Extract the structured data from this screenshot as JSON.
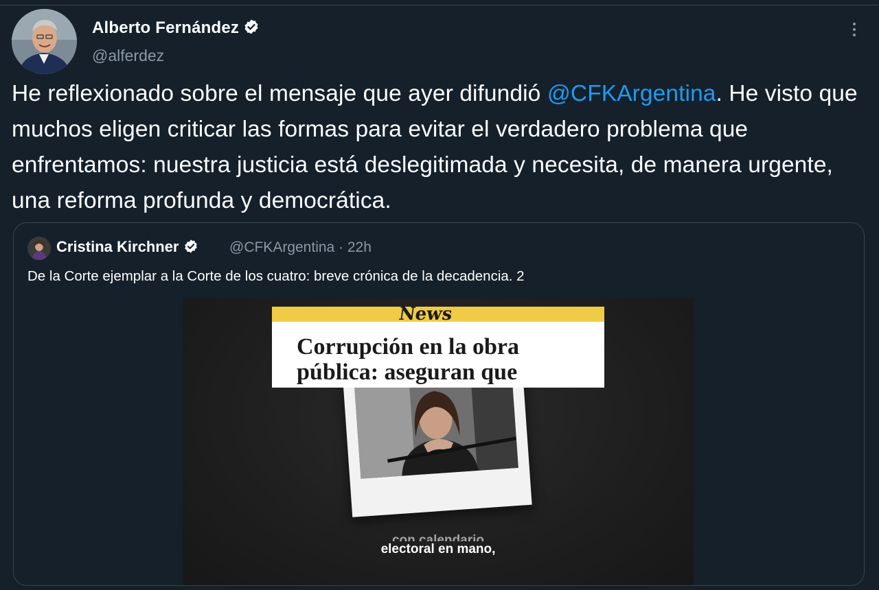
{
  "tweet": {
    "author": {
      "name": "Alberto Fernández",
      "handle": "@alferdez",
      "verified": true
    },
    "text_before_mention": "He reflexionado sobre el mensaje que ayer difundió ",
    "mention": "@CFKArgentina",
    "text_after_mention": ". He visto que muchos eligen criticar las formas para evitar el verdadero problema que enfrentamos: nuestra justicia está deslegitimada y necesita, de manera urgente, una reforma profunda y democrática.",
    "more_icon": "more-vertical-icon"
  },
  "quoted_tweet": {
    "author_name": "Cristina Kirchner",
    "verified": true,
    "handle_time": "@CFKArgentina · 22h",
    "text": "De la Corte ejemplar a la Corte de los cuatro: breve crónica de la decadencia. 2",
    "media": {
      "logo": "News",
      "headline": "Corrupción en la obra pública: aseguran que",
      "caption_partial": "con calendario",
      "caption": "electoral en mano,"
    }
  },
  "colors": {
    "background": "#15202b",
    "border": "#38444d",
    "secondary_text": "#8b98a5",
    "link": "#1d9bf0",
    "verified_badge": "#ffffff",
    "news_yellow": "#f1cb46"
  }
}
